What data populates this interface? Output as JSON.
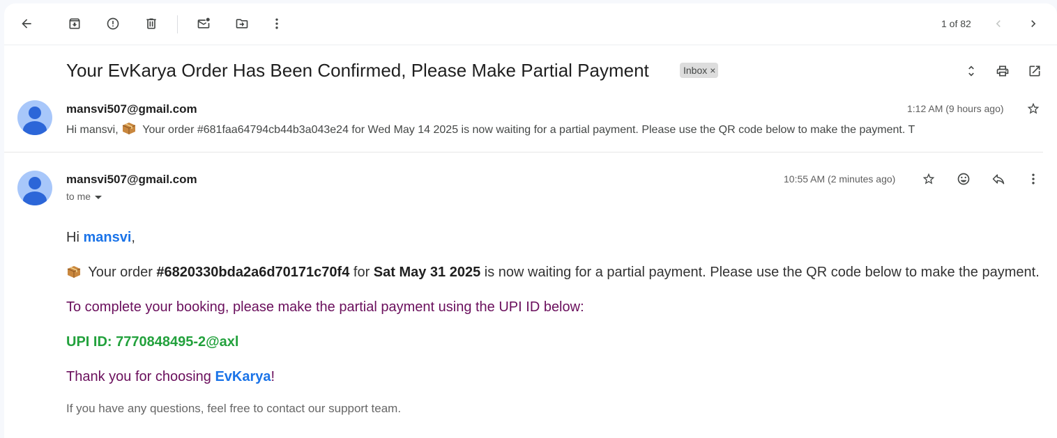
{
  "toolbar": {
    "pager": "1 of 82"
  },
  "thread": {
    "subject": "Your EvKarya Order Has Been Confirmed, Please Make Partial Payment",
    "label": "Inbox",
    "label_close": "×"
  },
  "collapsed_message": {
    "sender": "mansvi507@gmail.com",
    "time": "1:12 AM (9 hours ago)",
    "snippet_pre": "Hi mansvi, ",
    "snippet_post": " Your order #681faa64794cb44b3a043e24 for Wed May 14 2025 is now waiting for a partial payment. Please use the QR code below to make the payment. T"
  },
  "open_message": {
    "sender": "mansvi507@gmail.com",
    "time": "10:55 AM (2 minutes ago)",
    "recipient": "to me",
    "greeting_pre": "Hi ",
    "greeting_name": "mansvi",
    "greeting_post": ",",
    "order_pre": " Your order ",
    "order_id": "#6820330bda2a6d70171c70f4",
    "order_mid": " for ",
    "order_date": "Sat May 31 2025",
    "order_post": " is now waiting for a partial payment. Please use the QR code below to make the payment.",
    "instruction": "To complete your booking, please make the partial payment using the UPI ID below:",
    "upi": "UPI ID: 7770848495-2@axl",
    "thanks_pre": "Thank you for choosing ",
    "thanks_brand": "EvKarya",
    "thanks_post": "!",
    "footer": "If you have any questions, feel free to contact our support team."
  },
  "icons": [
    "back-arrow-icon",
    "archive-icon",
    "report-spam-icon",
    "delete-icon",
    "mark-unread-icon",
    "move-to-icon",
    "more-vert-icon",
    "chevron-left-icon",
    "chevron-right-icon",
    "expand-collapse-icon",
    "print-icon",
    "open-in-new-icon",
    "star-icon",
    "emoji-icon",
    "reply-icon",
    "package-emoji-icon"
  ],
  "colors": {
    "link_blue": "#1a73e8",
    "purple_text": "#6a0f5c",
    "green_text": "#22a13c",
    "avatar_bg": "#a8c7fa",
    "avatar_fg": "#2c66d8"
  }
}
